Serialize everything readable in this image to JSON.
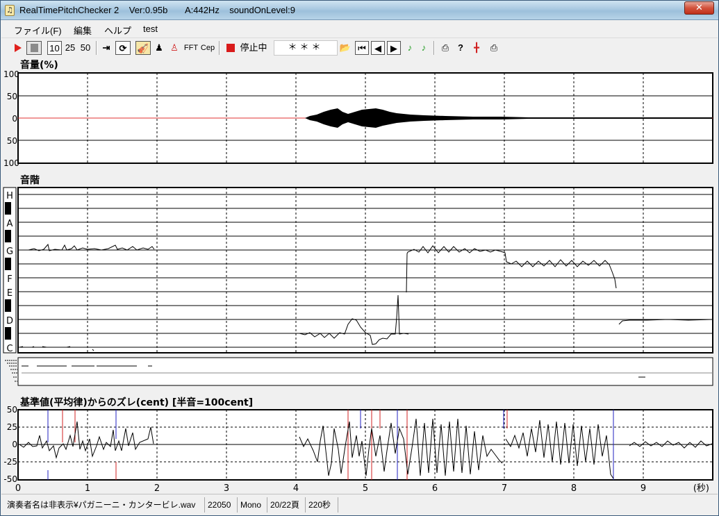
{
  "window": {
    "title": "RealTimePitchChecker 2    Ver:0.95b       A:442Hz    soundOnLevel:9",
    "close_label": "✕"
  },
  "menu": [
    "ファイル(F)",
    "編集",
    "ヘルプ",
    "test"
  ],
  "toolbar": {
    "speeds": [
      "10",
      "25",
      "50"
    ],
    "fft_label": "FFT",
    "cep_label": "Cep",
    "status_label": "停止中",
    "ref_value": "＊＊＊"
  },
  "volume_pane": {
    "label": "音量(%)",
    "ticks": [
      "100",
      "50",
      "0",
      "50",
      "100"
    ]
  },
  "scale_pane": {
    "label": "音階",
    "notes": [
      "H",
      "A",
      "G",
      "F",
      "E",
      "D",
      "C"
    ]
  },
  "cent_pane": {
    "label": "基準値(平均律)からのズレ(cent) [半音=100cent]",
    "ticks": [
      "50",
      "25",
      "0",
      "-25",
      "-50"
    ],
    "x_ticks": [
      "0",
      "1",
      "2",
      "3",
      "4",
      "5",
      "6",
      "7",
      "8",
      "9"
    ],
    "x_unit": "(秒)"
  },
  "status": {
    "file": "演奏者名は非表示¥パガニーニ・カンタービレ.wav",
    "rate": "22050",
    "channels": "Mono",
    "pages": "20/22頁",
    "length": "220秒"
  }
}
